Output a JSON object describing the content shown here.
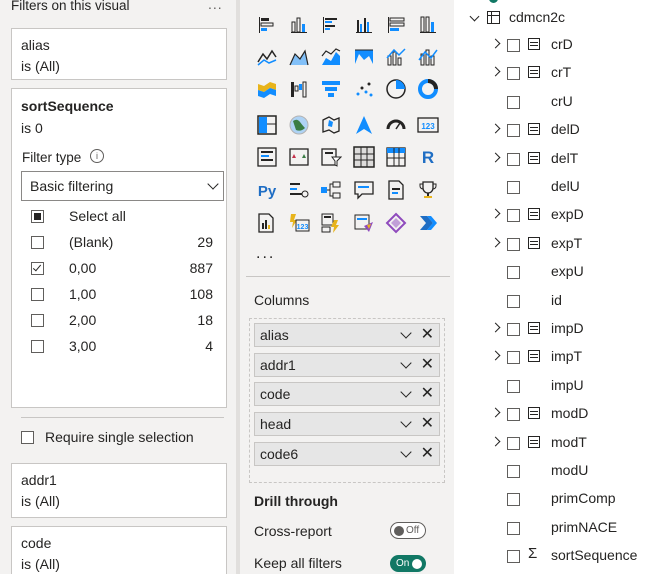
{
  "filters": {
    "title": "Filters on this visual",
    "more": "...",
    "cards": {
      "alias": {
        "name": "alias",
        "condition": "is (All)"
      },
      "sort": {
        "name": "sortSequence",
        "condition": "is 0",
        "filter_type_label": "Filter type",
        "filter_type_value": "Basic filtering",
        "options": [
          {
            "label": "Select all",
            "count": "",
            "state": "partial"
          },
          {
            "label": "(Blank)",
            "count": "29",
            "state": "unchecked"
          },
          {
            "label": "0,00",
            "count": "887",
            "state": "checked"
          },
          {
            "label": "1,00",
            "count": "108",
            "state": "unchecked"
          },
          {
            "label": "2,00",
            "count": "18",
            "state": "unchecked"
          },
          {
            "label": "3,00",
            "count": "4",
            "state": "unchecked"
          }
        ],
        "require_single": "Require single selection"
      },
      "addr1": {
        "name": "addr1",
        "condition": "is (All)"
      },
      "code": {
        "name": "code",
        "condition": "is (All)"
      }
    }
  },
  "viz": {
    "icons": [
      "stacked-bar-icon",
      "stacked-column-icon",
      "clustered-bar-icon",
      "clustered-column-icon",
      "100-bar-icon",
      "100-column-icon",
      "line-chart-icon",
      "area-chart-icon",
      "stacked-area-icon",
      "ribbon-chart-icon",
      "line-column-icon",
      "line-clustered-icon",
      "ribbon-icon",
      "waterfall-icon",
      "funnel-icon",
      "scatter-icon",
      "pie-icon",
      "donut-icon",
      "treemap-icon",
      "map-icon",
      "filled-map-icon",
      "azure-map-icon",
      "gauge-icon",
      "card-icon",
      "multirow-card-icon",
      "kpi-icon",
      "slicer-icon",
      "table-icon",
      "matrix-icon",
      "r-visual-icon",
      "python-visual-icon",
      "key-influencers-icon",
      "decomposition-tree-icon",
      "qa-icon",
      "smart-narrative-icon",
      "metrics-icon",
      "paginated-report-icon",
      "power-apps-icon",
      "power-automate-icon",
      "custom-visual-icon",
      "diamond-visual-icon",
      "chevron-visual-icon"
    ],
    "glyphs": {
      "card": "123",
      "r": "R",
      "py": "Py",
      "ellipsis": "..."
    },
    "columns_label": "Columns",
    "columns": [
      "alias",
      "addr1",
      "code",
      "head",
      "code6"
    ],
    "remove_glyph": "✕",
    "drill_through": "Drill through",
    "cross_report": "Cross-report",
    "cross_report_state": "Off",
    "keep_all_filters": "Keep all filters",
    "keep_all_filters_state": "On"
  },
  "data_pane": {
    "table": "cdmcn2c",
    "fields": [
      {
        "name": "crD",
        "expandable": true,
        "icon": "hierarchy"
      },
      {
        "name": "crT",
        "expandable": true,
        "icon": "hierarchy"
      },
      {
        "name": "crU",
        "expandable": false,
        "icon": ""
      },
      {
        "name": "delD",
        "expandable": true,
        "icon": "hierarchy"
      },
      {
        "name": "delT",
        "expandable": true,
        "icon": "hierarchy"
      },
      {
        "name": "delU",
        "expandable": false,
        "icon": ""
      },
      {
        "name": "expD",
        "expandable": true,
        "icon": "hierarchy"
      },
      {
        "name": "expT",
        "expandable": true,
        "icon": "hierarchy"
      },
      {
        "name": "expU",
        "expandable": false,
        "icon": ""
      },
      {
        "name": "id",
        "expandable": false,
        "icon": ""
      },
      {
        "name": "impD",
        "expandable": true,
        "icon": "hierarchy"
      },
      {
        "name": "impT",
        "expandable": true,
        "icon": "hierarchy"
      },
      {
        "name": "impU",
        "expandable": false,
        "icon": ""
      },
      {
        "name": "modD",
        "expandable": true,
        "icon": "hierarchy"
      },
      {
        "name": "modT",
        "expandable": true,
        "icon": "hierarchy"
      },
      {
        "name": "modU",
        "expandable": false,
        "icon": ""
      },
      {
        "name": "primComp",
        "expandable": false,
        "icon": ""
      },
      {
        "name": "primNACE",
        "expandable": false,
        "icon": ""
      },
      {
        "name": "sortSequence",
        "expandable": false,
        "icon": "sigma"
      }
    ],
    "sigma_glyph": "Σ"
  },
  "colors": {
    "accent": "#117865",
    "blue": "#118dff",
    "yellow": "#e8b41b",
    "purple": "#8f4bbd"
  }
}
